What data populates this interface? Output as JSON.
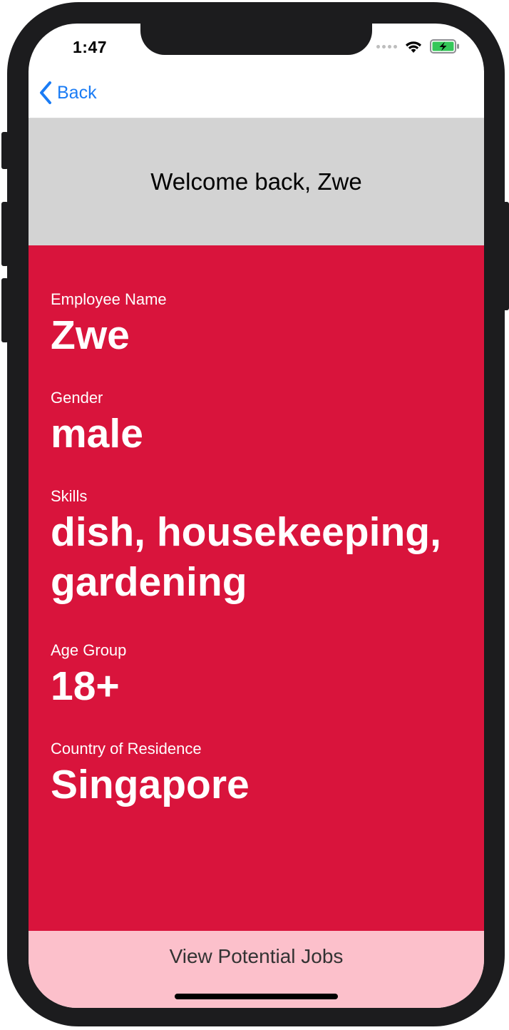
{
  "status_bar": {
    "time": "1:47"
  },
  "nav": {
    "back_label": "Back"
  },
  "header": {
    "welcome_text": "Welcome back, Zwe"
  },
  "profile": {
    "fields": [
      {
        "label": "Employee Name",
        "value": "Zwe"
      },
      {
        "label": "Gender",
        "value": "male"
      },
      {
        "label": "Skills",
        "value": "dish, housekeeping, gardening"
      },
      {
        "label": "Age Group",
        "value": "18+"
      },
      {
        "label": "Country of Residence",
        "value": "Singapore"
      }
    ]
  },
  "actions": {
    "view_jobs_label": "View Potential Jobs"
  },
  "colors": {
    "accent": "#1a7cf5",
    "profile_bg": "#d9143c",
    "header_bg": "#d3d3d3",
    "button_bg": "#fcc0cb",
    "battery": "#34c759"
  },
  "icons": {
    "back": "chevron-left-icon",
    "signal": "cellular-signal-icon",
    "wifi": "wifi-icon",
    "battery": "battery-charging-icon"
  }
}
